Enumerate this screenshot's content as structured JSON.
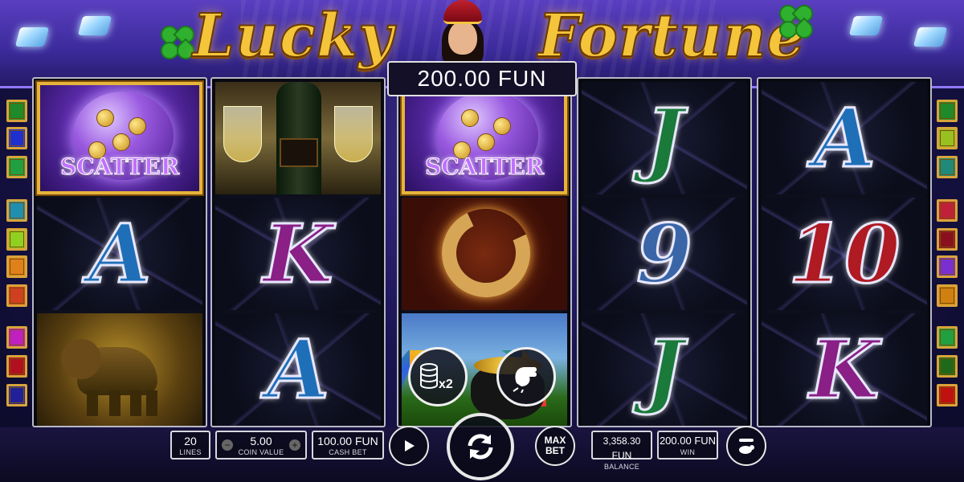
{
  "game": {
    "logo_word_1": "Lucky",
    "logo_word_2": "Fortune",
    "win_banner": "200.00 FUN"
  },
  "reels": [
    [
      "scatter",
      "A",
      "elephant"
    ],
    [
      "champagne",
      "K",
      "A"
    ],
    [
      "scatter",
      "horseshoe",
      "pot-of-gold"
    ],
    [
      "J",
      "9",
      "J"
    ],
    [
      "A",
      "10",
      "K"
    ]
  ],
  "symbols": {
    "scatter_label": "SCATTER",
    "colors": {
      "A": "#1f6fb8",
      "K": "#8a1f86",
      "J": "#1a7a3a",
      "9": "#3a66a8",
      "10": "#b01a22"
    }
  },
  "overlay_buttons": {
    "double_label": "x2",
    "double_icon": "coin-stack-icon",
    "gamble_icon": "fist-icon"
  },
  "paylines": {
    "left_colors": [
      "#1f8a2a",
      "#2030d0",
      "#20a040",
      "#1f8fb0",
      "#90d020",
      "#e0801a",
      "#d04020",
      "#c020c0",
      "#b01020",
      "#20209a"
    ],
    "right_colors": [
      "#1f8a2a",
      "#98c020",
      "#1f8a7a",
      "#c0203a",
      "#8a1020",
      "#7a30d0",
      "#d08010",
      "#20a040",
      "#1f6a1a",
      "#c01010"
    ]
  },
  "controls": {
    "lines": {
      "value": "20",
      "label": "LINES"
    },
    "coin_value": {
      "value": "5.00",
      "label": "COIN VALUE",
      "minus": "−",
      "plus": "+"
    },
    "cash_bet": {
      "value": "100.00 FUN",
      "label": "CASH BET"
    },
    "max_bet_line1": "MAX",
    "max_bet_line2": "BET",
    "balance": {
      "value": "3,358.30 FUN",
      "label": "BALANCE"
    },
    "win": {
      "value": "200.00 FUN",
      "label": "WIN"
    }
  }
}
